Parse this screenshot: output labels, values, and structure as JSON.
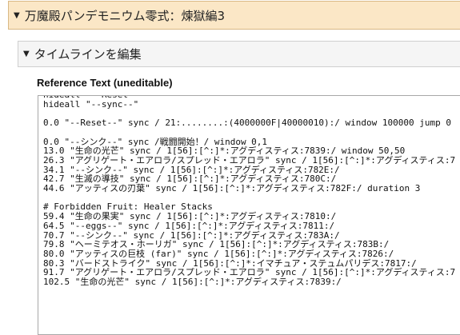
{
  "zone": {
    "title": "万魔殿パンデモニウム零式：煉獄編3"
  },
  "timeline_section": {
    "title": "タイムラインを編集"
  },
  "reference": {
    "label": "Reference Text (uneditable)",
    "lines": [
      "hideall \"--Reset--\"",
      "hideall \"--sync--\"",
      "",
      "0.0 \"--Reset--\" sync / 21:........:(4000000F|40000010):/ window 100000 jump 0",
      "",
      "0.0 \"--シンク--\" sync /戦闘開始！/ window 0,1",
      "13.0 \"生命の光芒\" sync / 1[56]:[^:]*:アグディスティス:7839:/ window 50,50",
      "26.3 \"アグリゲート・エアロラ/スプレッド・エアロラ\" sync / 1[56]:[^:]*:アグディスティス:7",
      "34.1 \"--シンク--\" sync / 1[56]:[^:]*:アグディスティス:782E:/",
      "42.7 \"生滅の導技\" sync / 1[56]:[^:]*:アグディスティス:780C:/",
      "44.6 \"アッティスの刃葉\" sync / 1[56]:[^:]*:アグディスティス:782F:/ duration 3",
      "",
      "# Forbidden Fruit: Healer Stacks",
      "59.4 \"生命の果実\" sync / 1[56]:[^:]*:アグディスティス:7810:/",
      "64.5 \"--eggs--\" sync / 1[56]:[^:]*:アグディスティス:7811:/",
      "70.7 \"--シンク--\" sync / 1[56]:[^:]*:アグディスティス:783A:/",
      "79.8 \"ヘーミテオス・ホーリガ\" sync / 1[56]:[^:]*:アグディスティス:783B:/",
      "80.0 \"アッティスの巨枝 (far)\" sync / 1[56]:[^:]*:アグディスティス:7826:/",
      "80.3 \"バードストライク\" sync / 1[56]:[^:]*:イマチュア・ステュムパリデス:7817:/",
      "91.7 \"アグリゲート・エアロラ/スプレッド・エアロラ\" sync / 1[56]:[^:]*:アグディスティス:7",
      "102.5 \"生命の光芒\" sync / 1[56]:[^:]*:アグディスティス:7839:/"
    ]
  }
}
